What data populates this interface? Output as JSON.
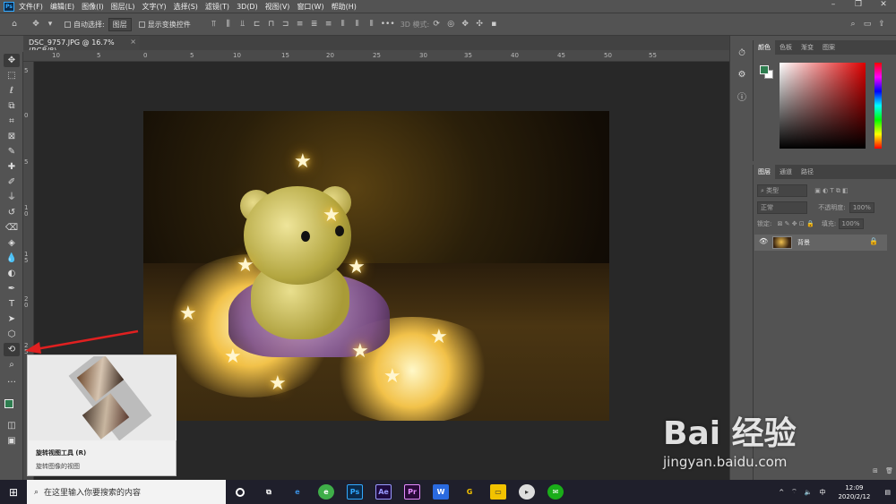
{
  "menu": {
    "items": [
      "文件(F)",
      "编辑(E)",
      "图像(I)",
      "图层(L)",
      "文字(Y)",
      "选择(S)",
      "滤镜(T)",
      "3D(D)",
      "视图(V)",
      "窗口(W)",
      "帮助(H)"
    ],
    "logo": "Ps"
  },
  "options": {
    "auto_select_label": "自动选择:",
    "auto_select_value": "图层",
    "show_transform_label": "显示变换控件",
    "mode_3d_label": "3D 模式:"
  },
  "document": {
    "tab_title": "DSC_9757.JPG @ 16.7%(RGB/8)",
    "close_glyph": "×"
  },
  "ruler": {
    "h_ticks": [
      "10",
      "5",
      "0",
      "5",
      "10",
      "15",
      "20",
      "25",
      "30",
      "35",
      "40",
      "45",
      "50",
      "55"
    ],
    "v_ticks": [
      "5",
      "0",
      "5",
      "1 0",
      "1 5",
      "2 0",
      "2 5"
    ]
  },
  "tooltip": {
    "title": "旋转视图工具 (R)",
    "description": "旋转图像的视图"
  },
  "color_panel": {
    "tabs": [
      "颜色",
      "色板",
      "渐变",
      "图案"
    ],
    "fg_color": "#2e7d4f",
    "bg_color": "#ffffff"
  },
  "layers_panel": {
    "tabs": [
      "图层",
      "通道",
      "路径"
    ],
    "filter_placeholder": "类型",
    "blend_mode": "正常",
    "opacity_label": "不透明度:",
    "opacity_value": "100%",
    "lock_label": "锁定:",
    "fill_label": "填充:",
    "fill_value": "100%",
    "layers": [
      {
        "name": "背景",
        "visible": true,
        "locked": true
      }
    ]
  },
  "taskbar": {
    "search_placeholder": "在这里输入你要搜索的内容",
    "apps": [
      "Ps",
      "Ae",
      "Pr"
    ],
    "ime": "中",
    "time": "12:09",
    "date": "2020/2/12"
  },
  "watermark": {
    "brand": "Bai 经验",
    "url": "jingyan.baidu.com"
  }
}
